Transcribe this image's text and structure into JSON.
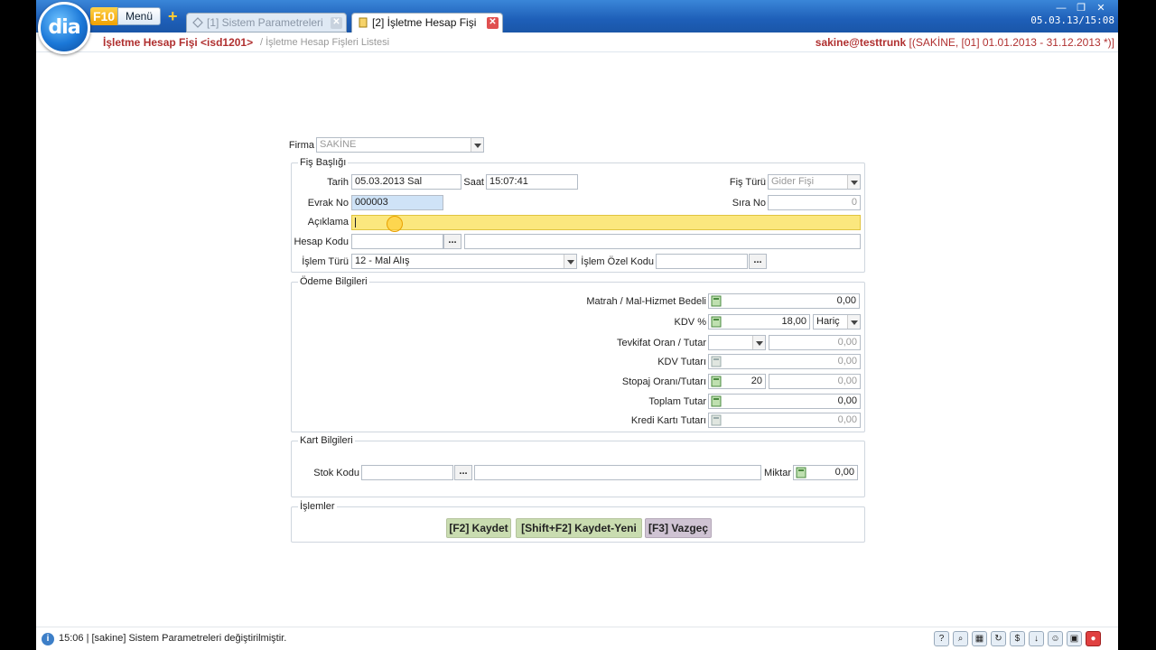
{
  "header": {
    "logo_text": "dia",
    "f10_label": "F10",
    "menu_label": "Menü",
    "tabs": [
      {
        "label": "[1] Sistem Parametreleri"
      },
      {
        "label": "[2] İşletme Hesap Fişi"
      }
    ],
    "clock": "05.03.13/15:08"
  },
  "breadcrumb": {
    "title": "İşletme Hesap Fişi <isd1201>",
    "sep": "/ İşletme Hesap Fişleri Listesi",
    "user": "sakine@testtrunk",
    "context": "[(SAKİNE, [01] 01.01.2013 - 31.12.2013 *)]"
  },
  "form": {
    "firma_label": "Firma",
    "firma_value": "SAKİNE",
    "fis_basligi_title": "Fiş Başlığı",
    "tarih_label": "Tarih",
    "tarih_value": "05.03.2013 Sal",
    "saat_label": "Saat",
    "saat_value": "15:07:41",
    "fis_turu_label": "Fiş Türü",
    "fis_turu_value": "Gider Fişi",
    "evrak_no_label": "Evrak No",
    "evrak_no_value": "000003",
    "sira_no_label": "Sıra No",
    "sira_no_value": "0",
    "aciklama_label": "Açıklama",
    "aciklama_value": "",
    "hesap_kodu_label": "Hesap Kodu",
    "hesap_kodu_value": "",
    "hesap_aciklama_value": "",
    "islem_turu_label": "İşlem Türü",
    "islem_turu_value": "12 - Mal Alış",
    "islem_ozel_kodu_label": "İşlem Özel Kodu",
    "islem_ozel_kodu_value": "",
    "ellipsis": "..."
  },
  "odeme": {
    "title": "Ödeme Bilgileri",
    "matrah_label": "Matrah / Mal-Hizmet Bedeli",
    "matrah_value": "0,00",
    "kdv_pct_label": "KDV %",
    "kdv_pct_value": "18,00",
    "kdv_mode_value": "Hariç",
    "tevkifat_label": "Tevkifat Oran / Tutar",
    "tevkifat_oran_value": "",
    "tevkifat_tutar_value": "0,00",
    "kdv_tutari_label": "KDV Tutarı",
    "kdv_tutari_value": "0,00",
    "stopaj_label": "Stopaj Oranı/Tutarı",
    "stopaj_oran_value": "20",
    "stopaj_tutar_value": "0,00",
    "toplam_label": "Toplam Tutar",
    "toplam_value": "0,00",
    "kredi_label": "Kredi Kartı Tutarı",
    "kredi_value": "0,00"
  },
  "kart": {
    "title": "Kart Bilgileri",
    "stok_kodu_label": "Stok Kodu",
    "stok_kodu_value": "",
    "stok_aciklama_value": "",
    "miktar_label": "Miktar",
    "miktar_value": "0,00"
  },
  "islemler": {
    "title": "İşlemler",
    "kaydet": "[F2] Kaydet",
    "kaydet_yeni": "[Shift+F2] Kaydet-Yeni",
    "vazgec": "[F3] Vazgeç"
  },
  "status": {
    "message": "15:06 | [sakine] Sistem Parametreleri değiştirilmiştir."
  },
  "colors": {
    "topbar": "#1e5fb8",
    "title_red": "#b03030",
    "highlight_yellow": "#fbe77e",
    "action_green": "#c9dcb0",
    "action_purple": "#cfc3d3"
  }
}
